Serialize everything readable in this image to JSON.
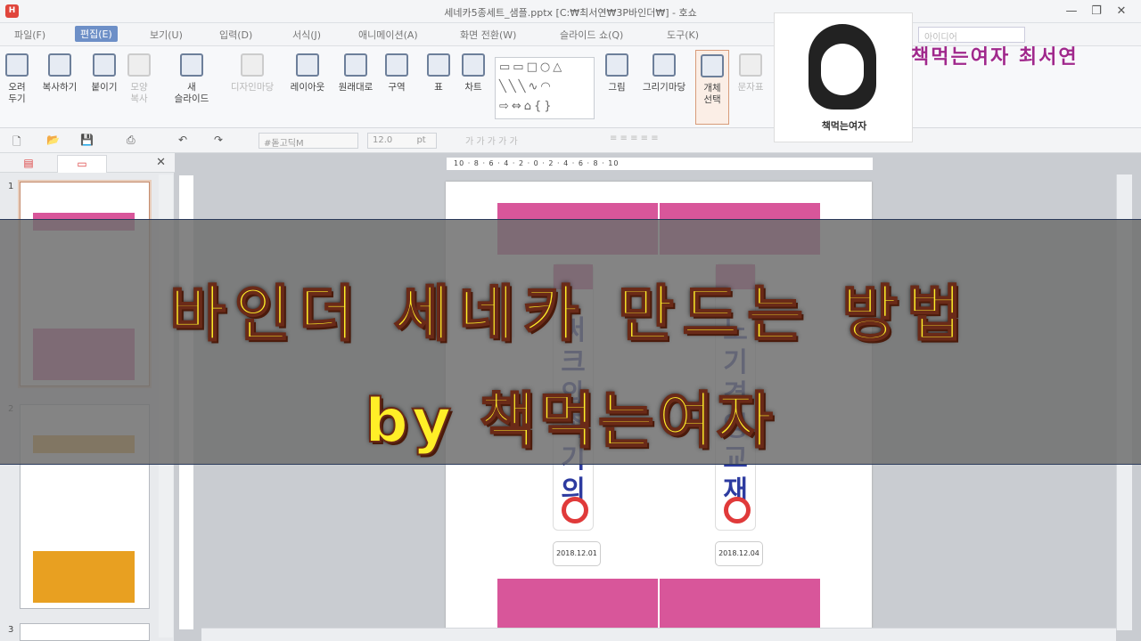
{
  "window": {
    "title": "세네카5종세트_샘플.pptx [C:₩최서연₩3P바인더₩] - 호쇼",
    "minimize": "—",
    "restore": "❐",
    "close": "✕"
  },
  "menu": {
    "items": [
      "파일(F)",
      "편집(E)",
      "보기(U)",
      "입력(D)",
      "서식(J)",
      "애니메이션(A)",
      "화면 전환(W)",
      "슬라이드 쇼(Q)",
      "도구(K)"
    ],
    "search_placeholder": "아이디어"
  },
  "ribbon": {
    "cut": "오려\n두기",
    "copy": "복사하기",
    "paste": "붙이기",
    "format_copy": "모양\n복사",
    "new_slide": "새\n슬라이드",
    "design": "디자인마당",
    "layout": "레이아웃",
    "reset": "원래대로",
    "section": "구역",
    "table": "표",
    "chart": "차트",
    "picture": "그림",
    "picture_yard": "그리기마당",
    "object_select": "개체\n선택",
    "text": "문자표"
  },
  "quickbar": {
    "font": "#돋고딕M",
    "size": "12.0",
    "unit": "pt"
  },
  "panel": {
    "close": "✕",
    "slide_numbers": [
      "1",
      "2",
      "3"
    ]
  },
  "ruler": {
    "h": "10 · 8 · 6 · 4 · 2 · 0 · 2 · 4 · 6 · 8 · 10"
  },
  "slide": {
    "dates": [
      "2018.12.01",
      "2018.12.04"
    ],
    "vtext_left": [
      "써",
      "크",
      "와",
      "족",
      "기",
      "의"
    ],
    "vtext_right": [
      "노",
      "기",
      "경",
      "영",
      "교",
      "재"
    ]
  },
  "overlay": {
    "line1": "바인더 세네카 만드는 방법",
    "line2": "by 책먹는여자"
  },
  "ad": {
    "brand": "책먹는여자 최서연",
    "caption": "책먹는여자"
  },
  "colors": {
    "magenta": "#d8569a",
    "orange": "#e8a021",
    "overlay_text": "#ffef27"
  }
}
